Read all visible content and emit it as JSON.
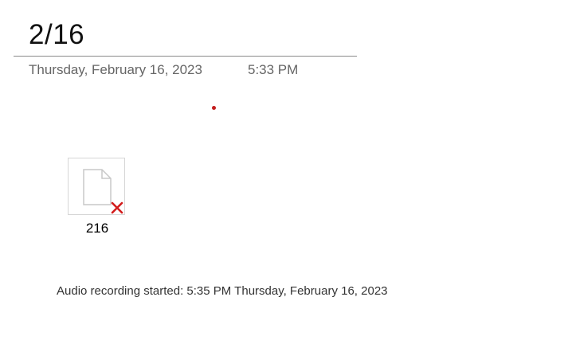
{
  "page": {
    "title": "2/16",
    "date": "Thursday, February 16, 2023",
    "time": "5:33 PM"
  },
  "attachment": {
    "label": "216",
    "icon": "document-icon",
    "status_icon": "error-x-icon"
  },
  "note": {
    "audio_text": "Audio recording started: 5:35 PM Thursday, February 16, 2023"
  },
  "colors": {
    "accent_red": "#c41e1e",
    "meta_gray": "#666666",
    "rule_gray": "#8a8a8a"
  }
}
